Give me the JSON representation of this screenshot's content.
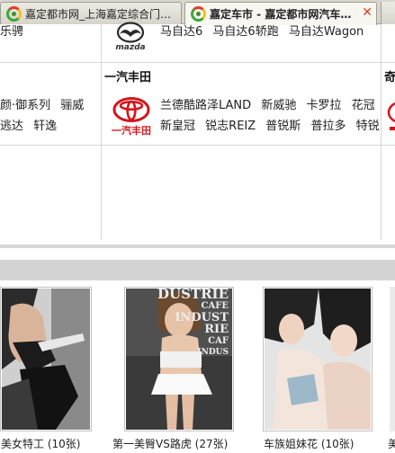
{
  "browser": {
    "tabs": [
      {
        "label": "嘉定都市网_上海嘉定综合门…",
        "active": false
      },
      {
        "label": "嘉定车市 - 嘉定都市网汽车…",
        "active": true
      }
    ]
  },
  "brands": {
    "row1": {
      "left_models": [
        "乐骋"
      ],
      "mazda": {
        "logo_text": "mazda",
        "models": [
          "马自达6",
          "马自达6轿跑",
          "马自达Wagon"
        ]
      }
    },
    "row2": {
      "left_models_line1": [
        "颜·御系列",
        "骊威"
      ],
      "left_models_line2": [
        "逃达",
        "轩逸"
      ],
      "faw_toyota": {
        "title": "一汽丰田",
        "logo_text": "一汽丰田",
        "models_line1": [
          "兰德酷路泽LAND",
          "新威驰",
          "卡罗拉",
          "花冠"
        ],
        "models_line2": [
          "新皇冠",
          "锐志REIZ",
          "普锐斯",
          "普拉多",
          "特锐"
        ]
      },
      "right_title_fragment": "奇"
    }
  },
  "gallery": {
    "items": [
      {
        "caption": "美女特工 (10张)"
      },
      {
        "caption": "第一美臀VS路虎 (27张)",
        "poster_text": [
          "DUSTRIE",
          "CAFE",
          "INDUST",
          "RIE",
          "CAF",
          "INDUS"
        ]
      },
      {
        "caption": "车族姐妹花 (10张)"
      },
      {
        "caption": "美"
      }
    ]
  },
  "colors": {
    "toyota_red": "#d4161d",
    "tab_close": "#d0431f",
    "section_bar": "#d3d3d3"
  }
}
